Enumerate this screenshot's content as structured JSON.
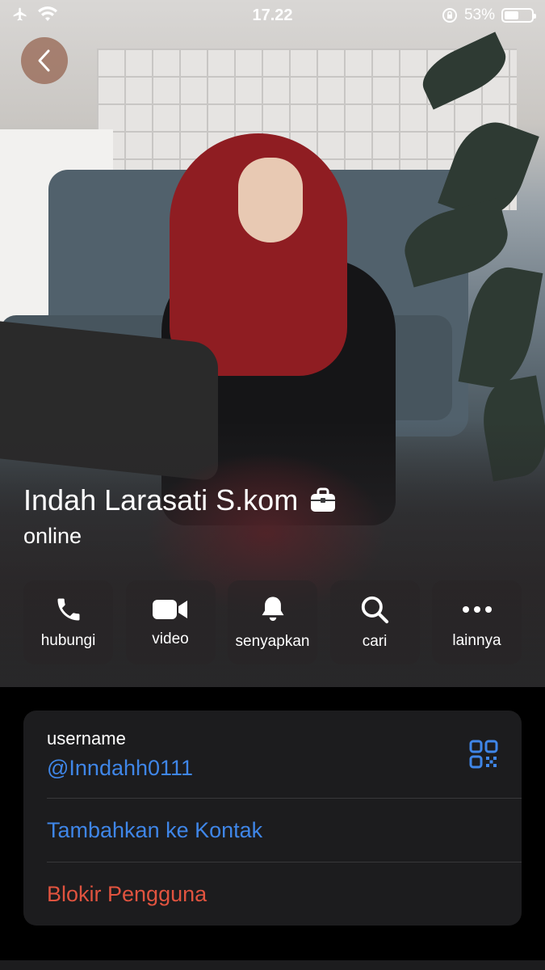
{
  "status_bar": {
    "time": "17.22",
    "battery_percent": "53%",
    "battery_level": 0.53,
    "icons": [
      "airplane-icon",
      "wifi-icon",
      "rotation-lock-icon",
      "battery-icon"
    ]
  },
  "profile": {
    "name": "Indah Larasati S.kom",
    "status": "online",
    "badge_icon": "briefcase-icon"
  },
  "actions": [
    {
      "label": "hubungi",
      "icon": "phone-icon"
    },
    {
      "label": "video",
      "icon": "video-camera-icon"
    },
    {
      "label": "senyapkan",
      "icon": "bell-icon"
    },
    {
      "label": "cari",
      "icon": "search-icon"
    },
    {
      "label": "lainnya",
      "icon": "more-icon"
    }
  ],
  "info": {
    "username_label": "username",
    "username_value": "@Inndahh0111",
    "add_contact": "Tambahkan ke Kontak",
    "block_user": "Blokir Pengguna"
  },
  "colors": {
    "link_blue": "#3f86e8",
    "destructive_red": "#e0533f",
    "card_bg": "#1c1c1e"
  }
}
